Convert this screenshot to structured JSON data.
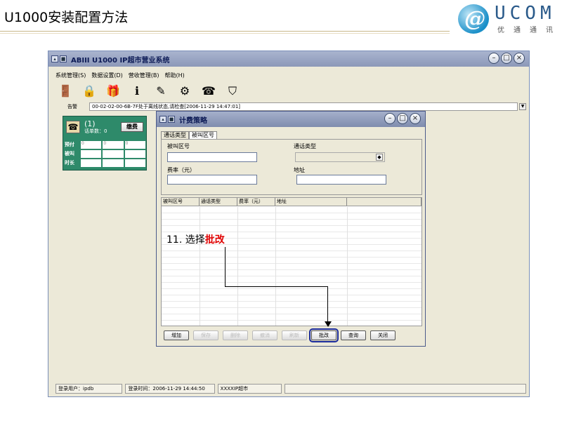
{
  "slide": {
    "title": "U1000安装配置方法"
  },
  "logo": {
    "mark": "@",
    "text": "UCOM",
    "sub": "优通通讯"
  },
  "app": {
    "title": "ABIII U1000 IP超市营业系统",
    "menu": [
      "系统管理(S)",
      "数据设置(D)",
      "营收管理(B)",
      "帮助(H)"
    ],
    "alert_label": "告警",
    "alert_text": "00-02-02-00-6B-7F处于离线状态,请检查[2006-11-29 14:47:01]",
    "terminal": {
      "num": "(1)",
      "count": "话单数：0",
      "pay": "缴费",
      "rows": [
        "预付",
        "被叫",
        "时长"
      ],
      "cell_vals": [
        "0",
        "0",
        "0"
      ]
    },
    "status": [
      "登录用户：ipdb",
      "登录时间：2006-11-29 14:44:50",
      "XXXXIP超市",
      "",
      ""
    ]
  },
  "dialog": {
    "title": "计费策略",
    "tabs": [
      "通话类型",
      "被叫区号"
    ],
    "labels": {
      "called": "被叫区号",
      "call_type": "通话类型",
      "rate": "费率（元）",
      "address": "地址"
    },
    "columns": [
      "被叫区号",
      "通话类型",
      "费率（元）",
      "地址",
      ""
    ],
    "buttons": [
      "增加",
      "保存",
      "删除",
      "撤消",
      "刷新",
      "批改",
      "查询",
      "关闭"
    ]
  },
  "annotation": {
    "prefix": "11. 选择",
    "highlight": "批改"
  }
}
